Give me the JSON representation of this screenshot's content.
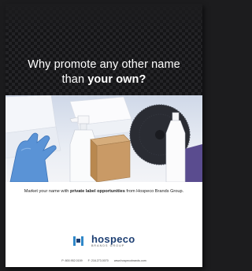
{
  "headline": {
    "line1": "Why promote any other name",
    "line2_prefix": "than ",
    "line2_bold": "your own?"
  },
  "tagline": {
    "prefix": "Market your name with ",
    "bold": "private label opportunities",
    "suffix": " from Hospeco Brands Group."
  },
  "logo": {
    "name": "hospeco",
    "subtitle": "BRANDS GROUP",
    "colors": {
      "navy": "#1d3f73",
      "blue": "#2f87c8"
    }
  },
  "contact": {
    "phone": "P: 800.952.0159",
    "fax": "F: 216.273.0070",
    "web": "www.hospecobrands.com"
  },
  "photo": {
    "items": [
      "glove-icon",
      "spray-bottle-icon",
      "box-icon",
      "floor-pad-icon",
      "bottle-icon",
      "wipes-icon",
      "towel-icon"
    ]
  }
}
